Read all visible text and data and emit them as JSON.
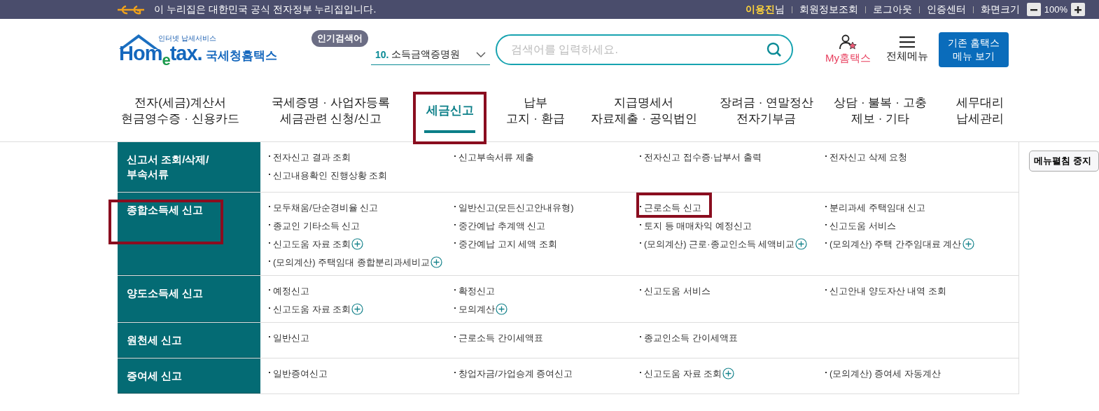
{
  "top_bar": {
    "notice": "이 누리집은 대한민국 공식 전자정부 누리집입니다.",
    "user_name": "이용진",
    "user_suffix": "님",
    "links": [
      "회원정보조회",
      "로그아웃",
      "인증센터"
    ],
    "zoom_label": "화면크기",
    "zoom_value": "100%"
  },
  "header": {
    "logo": {
      "tagline": "인터넷 납세서비스",
      "wordmark": "Hom$_{e}$tax.",
      "name": "국세청홈택스"
    },
    "popular": {
      "badge": "인기검색어",
      "rank": "10.",
      "value": "소득금액증명원"
    },
    "search": {
      "placeholder": "검색어를 입력하세요."
    },
    "my_hometax": "My홈택스",
    "all_menu": "전체메뉴",
    "legacy_button": [
      "기존 홈택스",
      "메뉴 보기"
    ]
  },
  "nav": [
    {
      "lines": [
        "전자(세금)계산서",
        "현금영수증 · 신용카드"
      ],
      "selected": false,
      "highlighted": false
    },
    {
      "lines": [
        "국세증명 · 사업자등록",
        "세금관련 신청/신고"
      ],
      "selected": false,
      "highlighted": false
    },
    {
      "lines": [
        "세금신고"
      ],
      "selected": true,
      "highlighted": true
    },
    {
      "lines": [
        "납부",
        "고지 · 환급"
      ],
      "selected": false,
      "highlighted": false
    },
    {
      "lines": [
        "지급명세서",
        "자료제출 · 공익법인"
      ],
      "selected": false,
      "highlighted": false
    },
    {
      "lines": [
        "장려금 · 연말정산",
        "전자기부금"
      ],
      "selected": false,
      "highlighted": false
    },
    {
      "lines": [
        "상담 · 불복 · 고충",
        "제보 · 기타"
      ],
      "selected": false,
      "highlighted": false
    },
    {
      "lines": [
        "세무대리",
        "납세관리"
      ],
      "selected": false,
      "highlighted": false
    }
  ],
  "menu": {
    "sections": [
      {
        "title": "신고서 조회/삭제/\n부속서류",
        "highlighted": false,
        "items": [
          {
            "label": "전자신고 결과 조회",
            "plus": false,
            "highlighted": false
          },
          {
            "label": "신고부속서류 제출",
            "plus": false,
            "highlighted": false
          },
          {
            "label": "전자신고 접수증·납부서 출력",
            "plus": false,
            "highlighted": false
          },
          {
            "label": "전자신고 삭제 요청",
            "plus": false,
            "highlighted": false
          },
          {
            "label": "신고내용확인 진행상황 조회",
            "plus": false,
            "highlighted": false
          }
        ]
      },
      {
        "title": "종합소득세 신고",
        "highlighted": true,
        "items": [
          {
            "label": "모두채움/단순경비율 신고",
            "plus": false,
            "highlighted": false
          },
          {
            "label": "일반신고(모든신고안내유형)",
            "plus": false,
            "highlighted": false
          },
          {
            "label": "근로소득 신고",
            "plus": false,
            "highlighted": true
          },
          {
            "label": "분리과세 주택임대 신고",
            "plus": false,
            "highlighted": false
          },
          {
            "label": "종교인 기타소득 신고",
            "plus": false,
            "highlighted": false
          },
          {
            "label": "중간예납 추계액 신고",
            "plus": false,
            "highlighted": false
          },
          {
            "label": "토지 등 매매차익 예정신고",
            "plus": false,
            "highlighted": false
          },
          {
            "label": "신고도움 서비스",
            "plus": false,
            "highlighted": false
          },
          {
            "label": "신고도움 자료 조회",
            "plus": true,
            "highlighted": false
          },
          {
            "label": "중간예납 고지 세액 조회",
            "plus": false,
            "highlighted": false
          },
          {
            "label": "(모의계산) 근로·종교인소득 세액비교",
            "plus": true,
            "highlighted": false
          },
          {
            "label": "(모의계산) 주택 간주임대료 계산",
            "plus": true,
            "highlighted": false
          },
          {
            "label": "(모의계산) 주택임대 종합분리과세비교",
            "plus": true,
            "highlighted": false
          }
        ]
      },
      {
        "title": "양도소득세 신고",
        "highlighted": false,
        "items": [
          {
            "label": "예정신고",
            "plus": false,
            "highlighted": false
          },
          {
            "label": "확정신고",
            "plus": false,
            "highlighted": false
          },
          {
            "label": "신고도움 서비스",
            "plus": false,
            "highlighted": false
          },
          {
            "label": "신고안내 양도자산 내역 조회",
            "plus": false,
            "highlighted": false
          },
          {
            "label": "신고도움 자료 조회",
            "plus": true,
            "highlighted": false
          },
          {
            "label": "모의계산",
            "plus": true,
            "highlighted": false
          }
        ]
      },
      {
        "title": "원천세 신고",
        "highlighted": false,
        "items": [
          {
            "label": "일반신고",
            "plus": false,
            "highlighted": false
          },
          {
            "label": "근로소득 간이세액표",
            "plus": false,
            "highlighted": false
          },
          {
            "label": "종교인소득 간이세액표",
            "plus": false,
            "highlighted": false
          }
        ]
      },
      {
        "title": "증여세 신고",
        "highlighted": false,
        "items": [
          {
            "label": "일반증여신고",
            "plus": false,
            "highlighted": false
          },
          {
            "label": "창업자금/가업승계 증여신고",
            "plus": false,
            "highlighted": false
          },
          {
            "label": "신고도움 자료 조회",
            "plus": true,
            "highlighted": false
          },
          {
            "label": "(모의계산) 증여세 자동계산",
            "plus": false,
            "highlighted": false
          }
        ]
      }
    ],
    "stop_button": "메뉴펼침 중지"
  }
}
